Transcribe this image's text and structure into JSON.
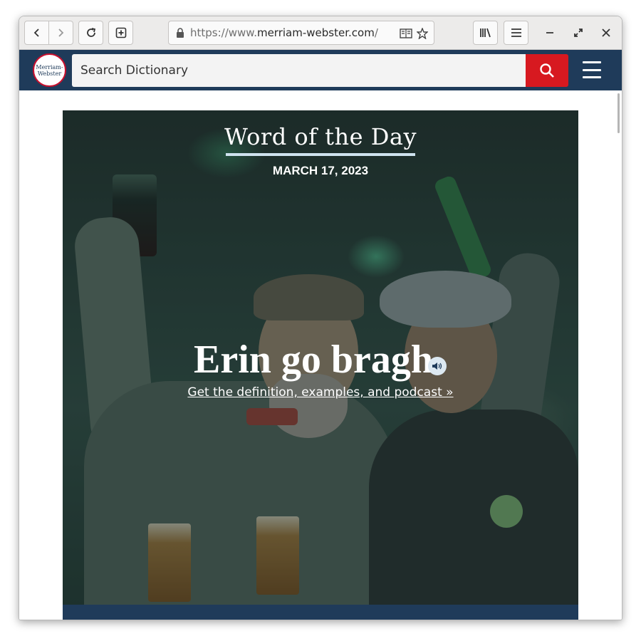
{
  "browser": {
    "url_prefix": "https://www.",
    "url_host": "merriam-webster.com",
    "url_suffix": "/"
  },
  "header": {
    "logo_line1": "Merriam-",
    "logo_line2": "Webster",
    "search_placeholder": "Search Dictionary"
  },
  "word_of_the_day": {
    "heading": "Word of the Day",
    "date": "MARCH 17, 2023",
    "word": "Erin go bragh",
    "link": "Get the definition, examples, and podcast »"
  },
  "colors": {
    "header_bg": "#1f3b5a",
    "search_button": "#d71920",
    "toolbar_bg": "#ecebea"
  },
  "icons": [
    "back-icon",
    "forward-icon",
    "reload-icon",
    "new-tab-icon",
    "lock-icon",
    "reader-view-icon",
    "bookmark-star-icon",
    "library-icon",
    "hamburger-menu-icon",
    "minimize-icon",
    "maximize-icon",
    "close-icon",
    "search-icon",
    "menu-icon",
    "audio-icon"
  ]
}
